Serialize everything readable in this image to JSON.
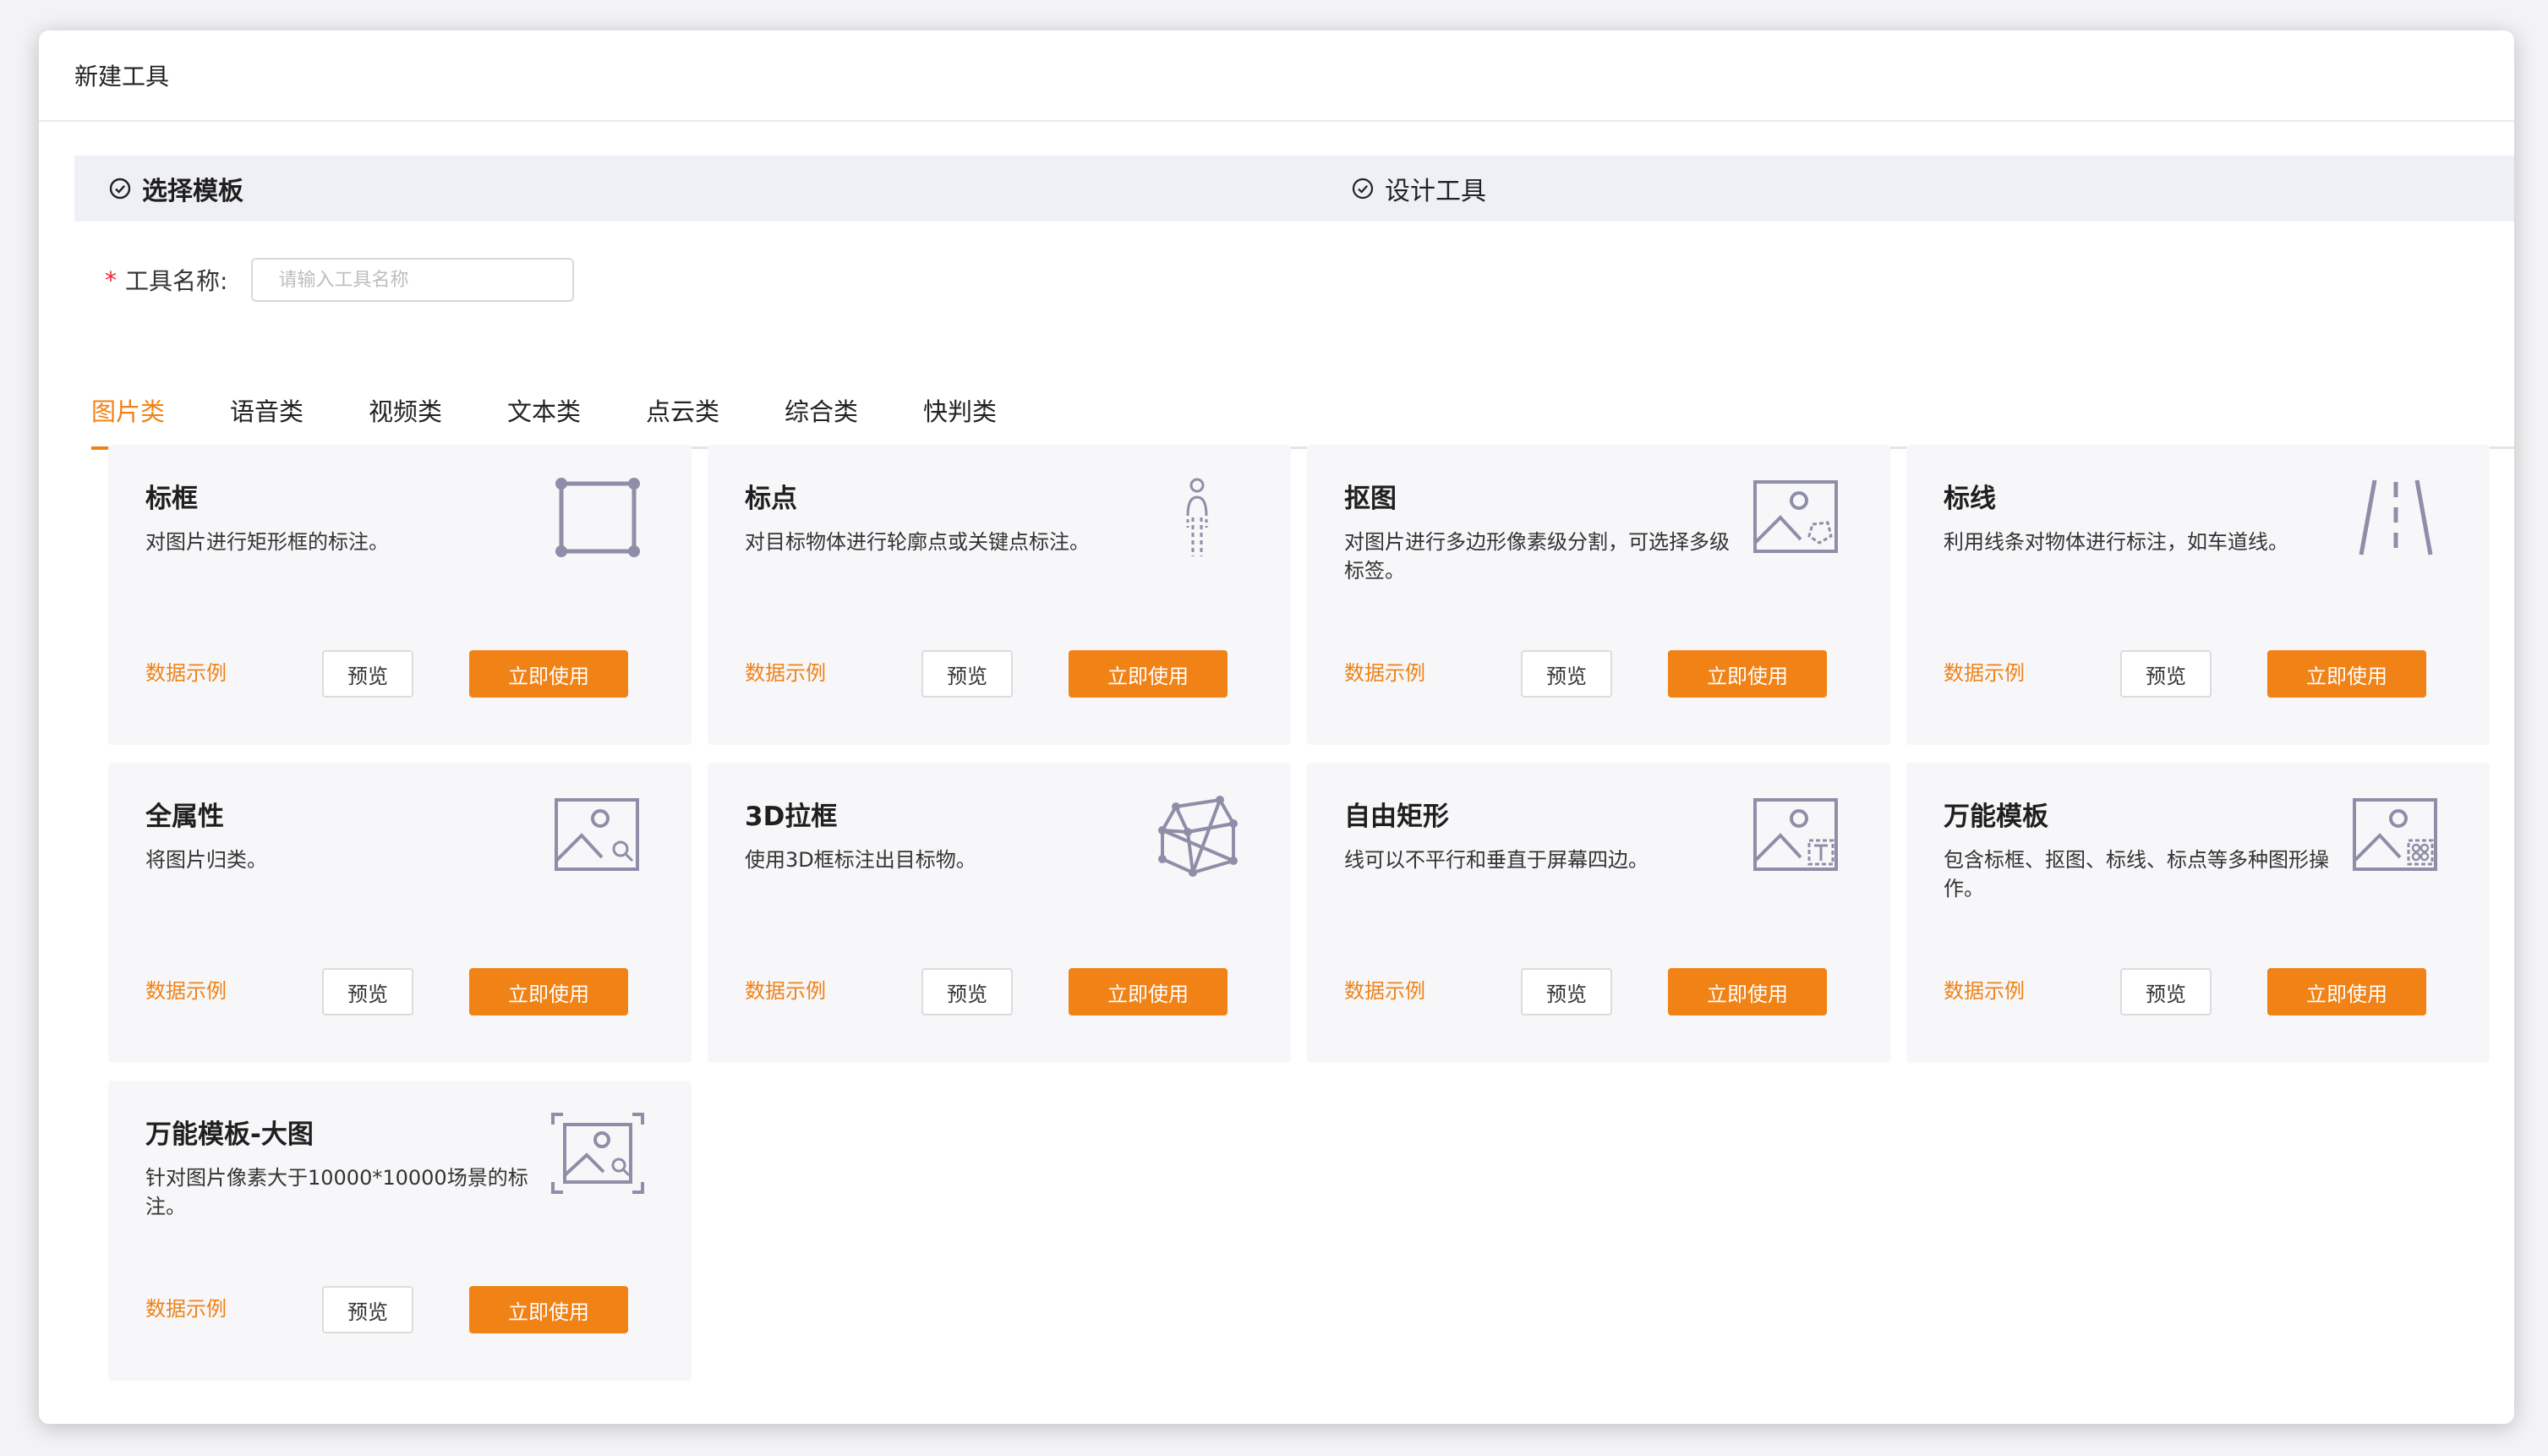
{
  "window": {
    "title": "新建工具"
  },
  "steps": [
    {
      "label": "选择模板",
      "icon": "check-circle-icon"
    },
    {
      "label": "设计工具",
      "icon": "check-circle-icon"
    }
  ],
  "tool_name": {
    "label": "工具名称:",
    "required_mark": "*",
    "placeholder": "请输入工具名称",
    "value": ""
  },
  "tabs": [
    {
      "label": "图片类",
      "active": true
    },
    {
      "label": "语音类",
      "active": false
    },
    {
      "label": "视频类",
      "active": false
    },
    {
      "label": "文本类",
      "active": false
    },
    {
      "label": "点云类",
      "active": false
    },
    {
      "label": "综合类",
      "active": false
    },
    {
      "label": "快判类",
      "active": false
    }
  ],
  "colors": {
    "accent": "#f08216",
    "icon": "#8e8ea8",
    "card_bg": "#f7f7f9"
  },
  "cards": [
    {
      "title": "标框",
      "desc": "对图片进行矩形框的标注。",
      "icon": "bounding-box-icon",
      "example": "数据示例",
      "preview": "预览",
      "use": "立即使用"
    },
    {
      "title": "标点",
      "desc": "对目标物体进行轮廓点或关键点标注。",
      "icon": "keypoint-figure-icon",
      "example": "数据示例",
      "preview": "预览",
      "use": "立即使用"
    },
    {
      "title": "抠图",
      "desc": "对图片进行多边形像素级分割，可选择多级标签。",
      "icon": "image-polygon-icon",
      "example": "数据示例",
      "preview": "预览",
      "use": "立即使用"
    },
    {
      "title": "标线",
      "desc": "利用线条对物体进行标注，如车道线。",
      "icon": "lane-line-icon",
      "example": "数据示例",
      "preview": "预览",
      "use": "立即使用"
    },
    {
      "title": "全属性",
      "desc": "将图片归类。",
      "icon": "image-search-icon",
      "example": "数据示例",
      "preview": "预览",
      "use": "立即使用"
    },
    {
      "title": "3D拉框",
      "desc": "使用3D框标注出目标物。",
      "icon": "cube-3d-icon",
      "example": "数据示例",
      "preview": "预览",
      "use": "立即使用"
    },
    {
      "title": "自由矩形",
      "desc": "线可以不平行和垂直于屏幕四边。",
      "icon": "image-text-icon",
      "example": "数据示例",
      "preview": "预览",
      "use": "立即使用"
    },
    {
      "title": "万能模板",
      "desc": "包含标框、抠图、标线、标点等多种图形操作。",
      "icon": "image-multi-icon",
      "example": "数据示例",
      "preview": "预览",
      "use": "立即使用"
    },
    {
      "title": "万能模板-大图",
      "desc": "针对图片像素大于10000*10000场景的标注。",
      "icon": "image-large-icon",
      "example": "数据示例",
      "preview": "预览",
      "use": "立即使用"
    }
  ]
}
